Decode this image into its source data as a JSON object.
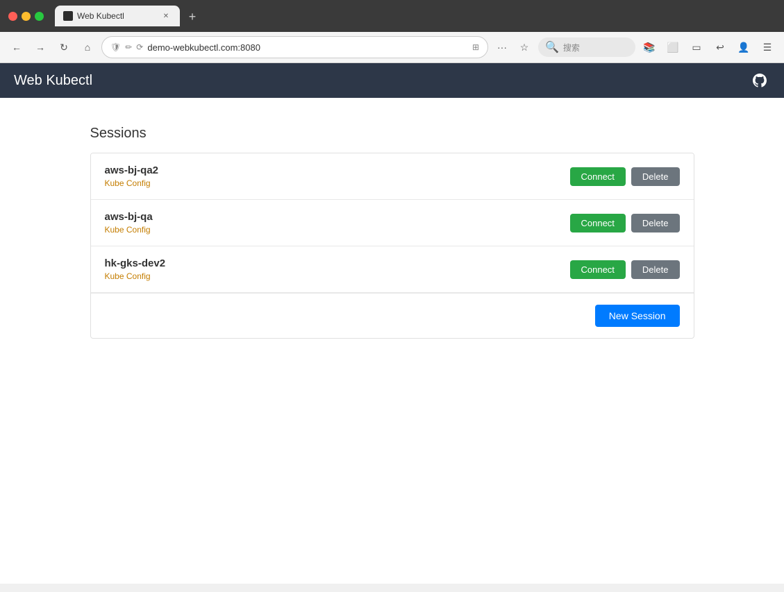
{
  "browser": {
    "tab_title": "Web Kubectl",
    "address": "demo-webkubectl.com:8080",
    "search_placeholder": "搜索",
    "new_tab_label": "+"
  },
  "app": {
    "title": "Web Kubectl",
    "github_icon": "⊕"
  },
  "sessions": {
    "heading": "Sessions",
    "items": [
      {
        "name": "aws-bj-qa2",
        "type": "Kube Config",
        "connect_label": "Connect",
        "delete_label": "Delete"
      },
      {
        "name": "aws-bj-qa",
        "type": "Kube Config",
        "connect_label": "Connect",
        "delete_label": "Delete"
      },
      {
        "name": "hk-gks-dev2",
        "type": "Kube Config",
        "connect_label": "Connect",
        "delete_label": "Delete"
      }
    ],
    "new_session_label": "New Session"
  }
}
